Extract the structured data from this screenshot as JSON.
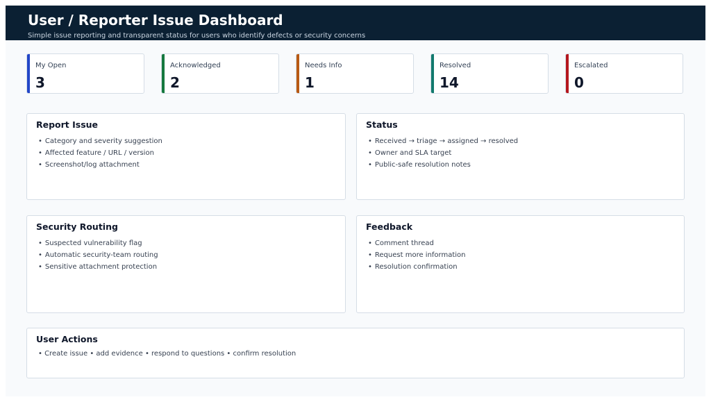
{
  "header": {
    "title": "User / Reporter Issue Dashboard",
    "subtitle": "Simple issue reporting and transparent status for users who identify defects or security concerns"
  },
  "kpis": [
    {
      "label": "My Open",
      "value": "3",
      "color": "#2346c8"
    },
    {
      "label": "Acknowledged",
      "value": "2",
      "color": "#16793f"
    },
    {
      "label": "Needs Info",
      "value": "1",
      "color": "#b85a14"
    },
    {
      "label": "Resolved",
      "value": "14",
      "color": "#127a6e"
    },
    {
      "label": "Escalated",
      "value": "0",
      "color": "#b4171e"
    }
  ],
  "panels": {
    "report_issue": {
      "title": "Report Issue",
      "items": [
        "Category and severity suggestion",
        "Affected feature / URL / version",
        "Screenshot/log attachment"
      ]
    },
    "status": {
      "title": "Status",
      "items": [
        "Received → triage → assigned → resolved",
        "Owner and SLA target",
        "Public-safe resolution notes"
      ]
    },
    "security_routing": {
      "title": "Security Routing",
      "items": [
        "Suspected vulnerability flag",
        "Automatic security-team routing",
        "Sensitive attachment protection"
      ]
    },
    "feedback": {
      "title": "Feedback",
      "items": [
        "Comment thread",
        "Request more information",
        "Resolution confirmation"
      ]
    },
    "user_actions": {
      "title": "User Actions",
      "text": "Create issue • add evidence • respond to questions • confirm resolution"
    }
  }
}
